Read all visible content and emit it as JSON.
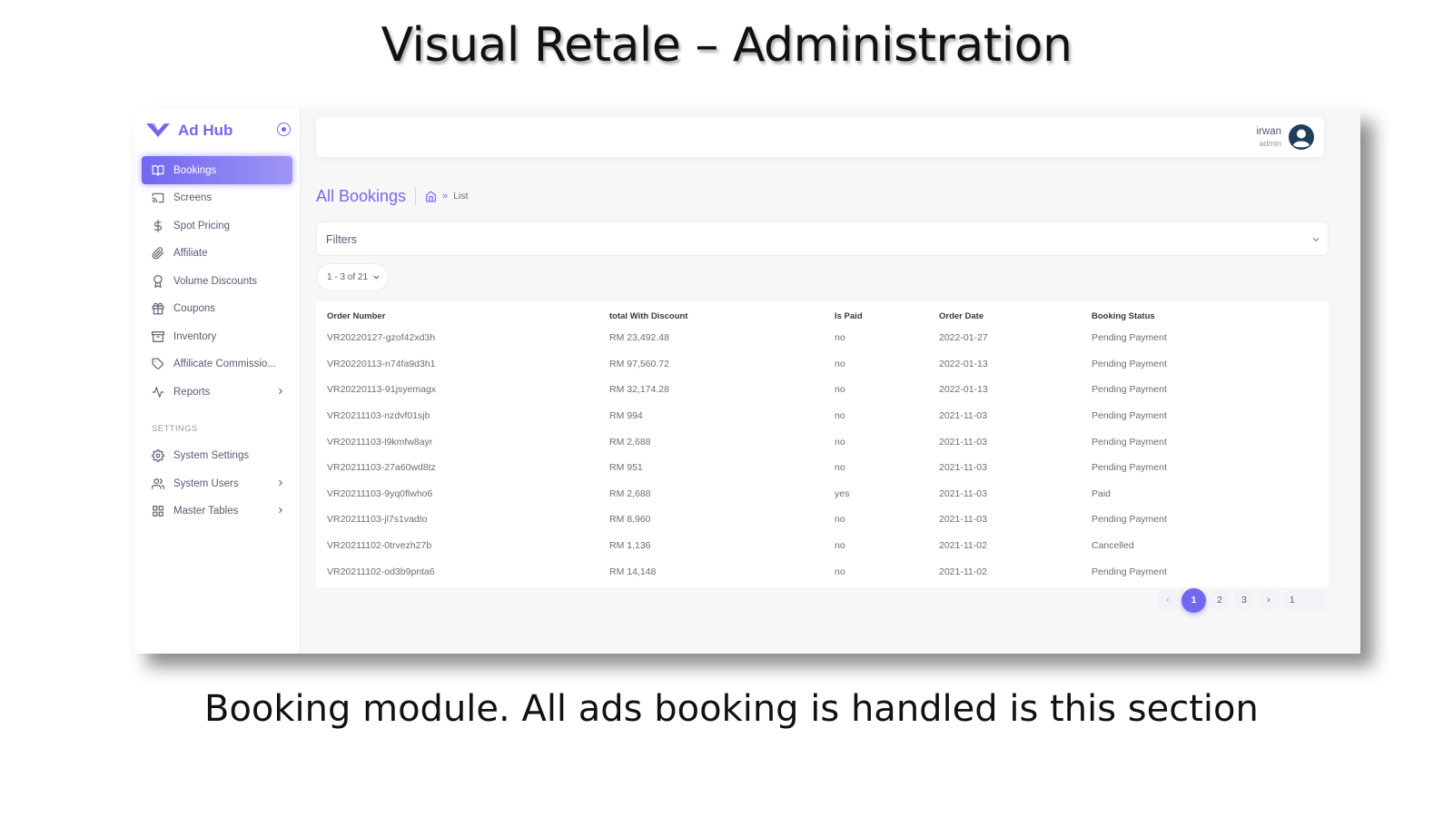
{
  "slide": {
    "title": "Visual Retale – Administration",
    "caption": "Booking module. All ads booking is handled is this section"
  },
  "colors": {
    "accent": "#7367f0",
    "text": "#5e5873",
    "muted": "#9b98a6"
  },
  "sidebar": {
    "brand": "Ad Hub",
    "items": [
      {
        "label": "Bookings",
        "icon": "book-open-icon",
        "active": true
      },
      {
        "label": "Screens",
        "icon": "cast-icon"
      },
      {
        "label": "Spot Pricing",
        "icon": "dollar-sign-icon"
      },
      {
        "label": "Affiliate",
        "icon": "paperclip-icon"
      },
      {
        "label": "Volume Discounts",
        "icon": "award-icon"
      },
      {
        "label": "Coupons",
        "icon": "gift-icon"
      },
      {
        "label": "Inventory",
        "icon": "archive-icon"
      },
      {
        "label": "Affilicate Commissio...",
        "icon": "tag-icon"
      },
      {
        "label": "Reports",
        "icon": "activity-icon",
        "has_children": true
      }
    ],
    "settings_heading": "SETTINGS",
    "settings_items": [
      {
        "label": "System Settings",
        "icon": "settings-icon"
      },
      {
        "label": "System Users",
        "icon": "users-icon",
        "has_children": true
      },
      {
        "label": "Master Tables",
        "icon": "grid-icon",
        "has_children": true
      }
    ]
  },
  "header": {
    "user_name": "irwan",
    "user_role": "admin"
  },
  "page": {
    "title": "All Bookings",
    "breadcrumb_current": "List",
    "filters_label": "Filters",
    "range_label": "1 - 3 of 21"
  },
  "table": {
    "columns": [
      "Order Number",
      "total With Discount",
      "Is Paid",
      "Order Date",
      "Booking Status"
    ],
    "rows": [
      [
        "VR20220127-gzof42xd3h",
        "RM 23,492.48",
        "no",
        "2022-01-27",
        "Pending Payment"
      ],
      [
        "VR20220113-n74fa9d3h1",
        "RM 97,560.72",
        "no",
        "2022-01-13",
        "Pending Payment"
      ],
      [
        "VR20220113-91jsyemagx",
        "RM 32,174.28",
        "no",
        "2022-01-13",
        "Pending Payment"
      ],
      [
        "VR20211103-nzdvf01sjb",
        "RM 994",
        "no",
        "2021-11-03",
        "Pending Payment"
      ],
      [
        "VR20211103-l9kmfw8ayr",
        "RM 2,688",
        "no",
        "2021-11-03",
        "Pending Payment"
      ],
      [
        "VR20211103-27a60wd8tz",
        "RM 951",
        "no",
        "2021-11-03",
        "Pending Payment"
      ],
      [
        "VR20211103-9yq0flwho6",
        "RM 2,688",
        "yes",
        "2021-11-03",
        "Paid"
      ],
      [
        "VR20211103-jl7s1vadto",
        "RM 8,960",
        "no",
        "2021-11-03",
        "Pending Payment"
      ],
      [
        "VR20211102-0trvezh27b",
        "RM 1,136",
        "no",
        "2021-11-02",
        "Cancelled"
      ],
      [
        "VR20211102-od3b9pnta6",
        "RM 14,148",
        "no",
        "2021-11-02",
        "Pending Payment"
      ]
    ]
  },
  "pagination": {
    "prev": "‹",
    "pages": [
      "1",
      "2",
      "3"
    ],
    "current": "1",
    "next": "›",
    "jump_value": "1"
  }
}
